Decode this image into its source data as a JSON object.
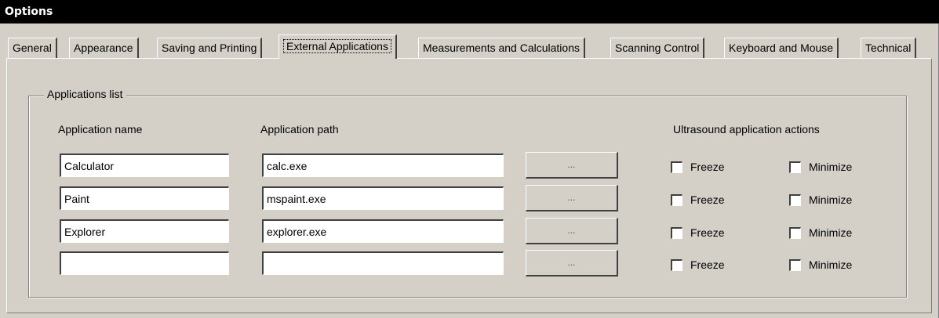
{
  "window": {
    "title": "Options"
  },
  "tabs": [
    {
      "label": "General"
    },
    {
      "label": "Appearance"
    },
    {
      "label": "Saving and Printing"
    },
    {
      "label": "External Applications",
      "selected": true
    },
    {
      "label": "Measurements and Calculations"
    },
    {
      "label": "Scanning Control"
    },
    {
      "label": "Keyboard and Mouse"
    },
    {
      "label": "Technical"
    }
  ],
  "applications": {
    "group_label": "Applications list",
    "name_header": "Application name",
    "path_header": "Application path",
    "actions_header": "Ultrasound application actions",
    "browse_label": "...",
    "freeze_label": "Freeze",
    "minimize_label": "Minimize",
    "rows": [
      {
        "name": "Calculator",
        "path": "calc.exe",
        "freeze": false,
        "minimize": false
      },
      {
        "name": "Paint",
        "path": "mspaint.exe",
        "freeze": false,
        "minimize": false
      },
      {
        "name": "Explorer",
        "path": "explorer.exe",
        "freeze": false,
        "minimize": false
      },
      {
        "name": "",
        "path": "",
        "freeze": false,
        "minimize": false
      }
    ]
  }
}
